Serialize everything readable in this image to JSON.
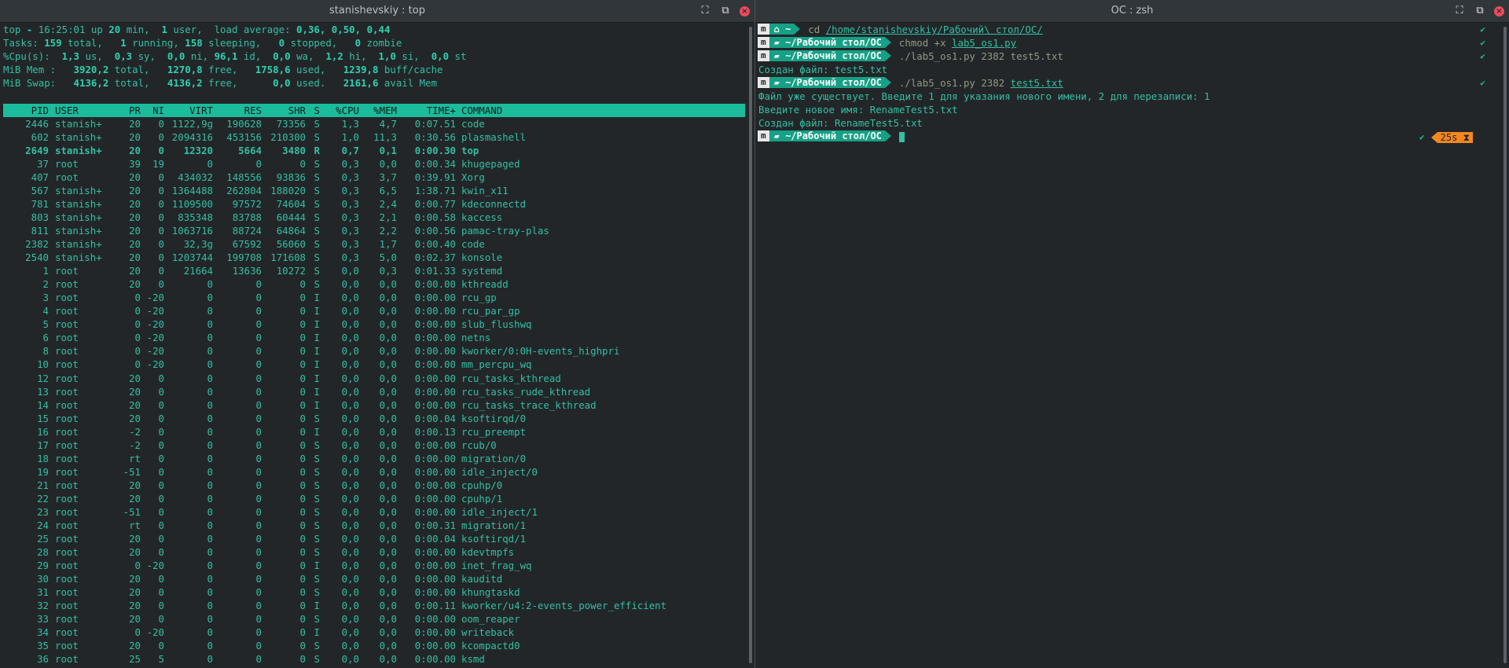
{
  "left_window": {
    "title": "stanishevskiy : top",
    "summary": [
      "top - 16:25:01 up 20 min,  1 user,  load average: 0,36, 0,50, 0,44",
      "Tasks: 159 total,   1 running, 158 sleeping,   0 stopped,   0 zombie",
      "%Cpu(s):  1,3 us,  0,3 sy,  0,0 ni, 96,1 id,  0,0 wa,  1,2 hi,  1,0 si,  0,0 st",
      "MiB Mem :   3920,2 total,   1270,8 free,   1758,6 used,   1239,8 buff/cache",
      "MiB Swap:   4136,2 total,   4136,2 free,      0,0 used.   2161,6 avail Mem"
    ],
    "columns": [
      "PID",
      "USER",
      "PR",
      "NI",
      "VIRT",
      "RES",
      "SHR",
      "S",
      "%CPU",
      "%MEM",
      "TIME+",
      "COMMAND"
    ],
    "processes": [
      [
        "2446",
        "stanish+",
        "20",
        "0",
        "1122,9g",
        "190628",
        "73356",
        "S",
        "1,3",
        "4,7",
        "0:07.51",
        "code"
      ],
      [
        "602",
        "stanish+",
        "20",
        "0",
        "2094316",
        "453156",
        "210300",
        "S",
        "1,0",
        "11,3",
        "0:30.56",
        "plasmashell"
      ],
      [
        "2649",
        "stanish+",
        "20",
        "0",
        "12320",
        "5664",
        "3480",
        "R",
        "0,7",
        "0,1",
        "0:00.30",
        "top"
      ],
      [
        "37",
        "root",
        "39",
        "19",
        "0",
        "0",
        "0",
        "S",
        "0,3",
        "0,0",
        "0:00.34",
        "khugepaged"
      ],
      [
        "407",
        "root",
        "20",
        "0",
        "434032",
        "148556",
        "93836",
        "S",
        "0,3",
        "3,7",
        "0:39.91",
        "Xorg"
      ],
      [
        "567",
        "stanish+",
        "20",
        "0",
        "1364488",
        "262804",
        "188020",
        "S",
        "0,3",
        "6,5",
        "1:38.71",
        "kwin_x11"
      ],
      [
        "781",
        "stanish+",
        "20",
        "0",
        "1109500",
        "97572",
        "74604",
        "S",
        "0,3",
        "2,4",
        "0:00.77",
        "kdeconnectd"
      ],
      [
        "803",
        "stanish+",
        "20",
        "0",
        "835348",
        "83788",
        "60444",
        "S",
        "0,3",
        "2,1",
        "0:00.58",
        "kaccess"
      ],
      [
        "811",
        "stanish+",
        "20",
        "0",
        "1063716",
        "88724",
        "64864",
        "S",
        "0,3",
        "2,2",
        "0:00.56",
        "pamac-tray-plas"
      ],
      [
        "2382",
        "stanish+",
        "20",
        "0",
        "32,3g",
        "67592",
        "56060",
        "S",
        "0,3",
        "1,7",
        "0:00.40",
        "code"
      ],
      [
        "2540",
        "stanish+",
        "20",
        "0",
        "1203744",
        "199708",
        "171608",
        "S",
        "0,3",
        "5,0",
        "0:02.37",
        "konsole"
      ],
      [
        "1",
        "root",
        "20",
        "0",
        "21664",
        "13636",
        "10272",
        "S",
        "0,0",
        "0,3",
        "0:01.33",
        "systemd"
      ],
      [
        "2",
        "root",
        "20",
        "0",
        "0",
        "0",
        "0",
        "S",
        "0,0",
        "0,0",
        "0:00.00",
        "kthreadd"
      ],
      [
        "3",
        "root",
        "0",
        "-20",
        "0",
        "0",
        "0",
        "I",
        "0,0",
        "0,0",
        "0:00.00",
        "rcu_gp"
      ],
      [
        "4",
        "root",
        "0",
        "-20",
        "0",
        "0",
        "0",
        "I",
        "0,0",
        "0,0",
        "0:00.00",
        "rcu_par_gp"
      ],
      [
        "5",
        "root",
        "0",
        "-20",
        "0",
        "0",
        "0",
        "I",
        "0,0",
        "0,0",
        "0:00.00",
        "slub_flushwq"
      ],
      [
        "6",
        "root",
        "0",
        "-20",
        "0",
        "0",
        "0",
        "I",
        "0,0",
        "0,0",
        "0:00.00",
        "netns"
      ],
      [
        "8",
        "root",
        "0",
        "-20",
        "0",
        "0",
        "0",
        "I",
        "0,0",
        "0,0",
        "0:00.00",
        "kworker/0:0H-events_highpri"
      ],
      [
        "10",
        "root",
        "0",
        "-20",
        "0",
        "0",
        "0",
        "I",
        "0,0",
        "0,0",
        "0:00.00",
        "mm_percpu_wq"
      ],
      [
        "12",
        "root",
        "20",
        "0",
        "0",
        "0",
        "0",
        "I",
        "0,0",
        "0,0",
        "0:00.00",
        "rcu_tasks_kthread"
      ],
      [
        "13",
        "root",
        "20",
        "0",
        "0",
        "0",
        "0",
        "I",
        "0,0",
        "0,0",
        "0:00.00",
        "rcu_tasks_rude_kthread"
      ],
      [
        "14",
        "root",
        "20",
        "0",
        "0",
        "0",
        "0",
        "I",
        "0,0",
        "0,0",
        "0:00.00",
        "rcu_tasks_trace_kthread"
      ],
      [
        "15",
        "root",
        "20",
        "0",
        "0",
        "0",
        "0",
        "S",
        "0,0",
        "0,0",
        "0:00.04",
        "ksoftirqd/0"
      ],
      [
        "16",
        "root",
        "-2",
        "0",
        "0",
        "0",
        "0",
        "I",
        "0,0",
        "0,0",
        "0:00.13",
        "rcu_preempt"
      ],
      [
        "17",
        "root",
        "-2",
        "0",
        "0",
        "0",
        "0",
        "S",
        "0,0",
        "0,0",
        "0:00.00",
        "rcub/0"
      ],
      [
        "18",
        "root",
        "rt",
        "0",
        "0",
        "0",
        "0",
        "S",
        "0,0",
        "0,0",
        "0:00.00",
        "migration/0"
      ],
      [
        "19",
        "root",
        "-51",
        "0",
        "0",
        "0",
        "0",
        "S",
        "0,0",
        "0,0",
        "0:00.00",
        "idle_inject/0"
      ],
      [
        "21",
        "root",
        "20",
        "0",
        "0",
        "0",
        "0",
        "S",
        "0,0",
        "0,0",
        "0:00.00",
        "cpuhp/0"
      ],
      [
        "22",
        "root",
        "20",
        "0",
        "0",
        "0",
        "0",
        "S",
        "0,0",
        "0,0",
        "0:00.00",
        "cpuhp/1"
      ],
      [
        "23",
        "root",
        "-51",
        "0",
        "0",
        "0",
        "0",
        "S",
        "0,0",
        "0,0",
        "0:00.00",
        "idle_inject/1"
      ],
      [
        "24",
        "root",
        "rt",
        "0",
        "0",
        "0",
        "0",
        "S",
        "0,0",
        "0,0",
        "0:00.31",
        "migration/1"
      ],
      [
        "25",
        "root",
        "20",
        "0",
        "0",
        "0",
        "0",
        "S",
        "0,0",
        "0,0",
        "0:00.04",
        "ksoftirqd/1"
      ],
      [
        "28",
        "root",
        "20",
        "0",
        "0",
        "0",
        "0",
        "S",
        "0,0",
        "0,0",
        "0:00.00",
        "kdevtmpfs"
      ],
      [
        "29",
        "root",
        "0",
        "-20",
        "0",
        "0",
        "0",
        "I",
        "0,0",
        "0,0",
        "0:00.00",
        "inet_frag_wq"
      ],
      [
        "30",
        "root",
        "20",
        "0",
        "0",
        "0",
        "0",
        "S",
        "0,0",
        "0,0",
        "0:00.00",
        "kauditd"
      ],
      [
        "31",
        "root",
        "20",
        "0",
        "0",
        "0",
        "0",
        "S",
        "0,0",
        "0,0",
        "0:00.00",
        "khungtaskd"
      ],
      [
        "32",
        "root",
        "20",
        "0",
        "0",
        "0",
        "0",
        "I",
        "0,0",
        "0,0",
        "0:00.11",
        "kworker/u4:2-events_power_efficient"
      ],
      [
        "33",
        "root",
        "20",
        "0",
        "0",
        "0",
        "0",
        "S",
        "0,0",
        "0,0",
        "0:00.00",
        "oom_reaper"
      ],
      [
        "34",
        "root",
        "0",
        "-20",
        "0",
        "0",
        "0",
        "I",
        "0,0",
        "0,0",
        "0:00.00",
        "writeback"
      ],
      [
        "35",
        "root",
        "20",
        "0",
        "0",
        "0",
        "0",
        "S",
        "0,0",
        "0,0",
        "0:00.00",
        "kcompactd0"
      ],
      [
        "36",
        "root",
        "25",
        "5",
        "0",
        "0",
        "0",
        "S",
        "0,0",
        "0,0",
        "0:00.00",
        "ksmd"
      ]
    ]
  },
  "right_window": {
    "title": "ОС : zsh",
    "lines": [
      {
        "dir": "~",
        "home": true,
        "cmd_plain": "cd ",
        "cmd_link": "/home/stanishevskiy/Рабочий\\ стол/ОС/",
        "cmd_tail": ""
      },
      {
        "dir": "~/Рабочий стол/ОС",
        "home": false,
        "cmd_plain": "chmod +x ",
        "cmd_link": "lab5_os1.py",
        "cmd_tail": ""
      },
      {
        "dir": "~/Рабочий стол/ОС",
        "home": false,
        "cmd_plain": "./lab5_os1.py 2382 test5.txt",
        "cmd_link": "",
        "cmd_tail": ""
      }
    ],
    "output1": "Создан файл: test5.txt",
    "line4": {
      "dir": "~/Рабочий стол/ОС",
      "cmd_plain": "./lab5_os1.py 2382 ",
      "cmd_link": "test5.txt"
    },
    "output2": [
      "Файл уже существует. Введите 1 для указания нового имени, 2 для перезаписи: 1",
      "Введите новое имя: RenameTest5.txt",
      "Создан файл: RenameTest5.txt"
    ],
    "last_prompt_dir": "~/Рабочий стол/ОС",
    "timer": "25s",
    "check_mark": "✔"
  },
  "icons": {
    "maximize": "maximize-icon",
    "new_tab": "new-tab-icon",
    "close": "close-icon",
    "os_logo": "manjaro-icon",
    "home": "home-icon",
    "folder": "folder-icon",
    "hourglass": "hourglass-icon"
  },
  "colors": {
    "accent": "#1abc9c",
    "text": "#33bfa3",
    "close": "#ed4b5a",
    "timer": "#f5871f"
  }
}
